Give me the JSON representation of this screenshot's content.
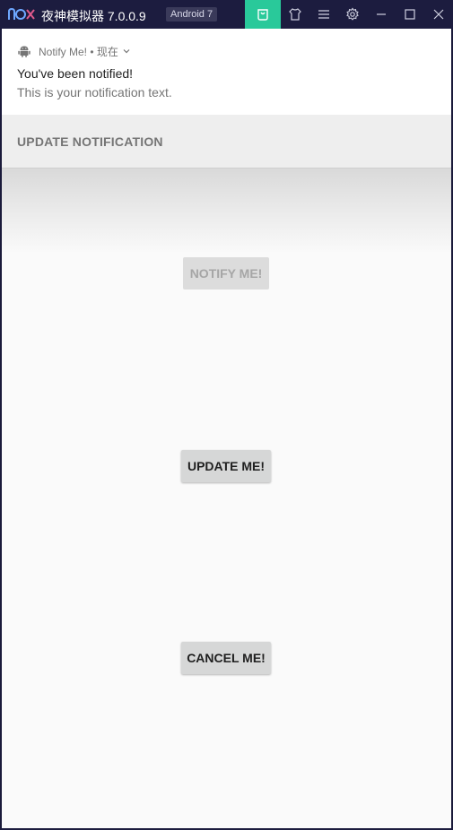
{
  "emulator": {
    "logo_text": "nox",
    "title": "夜神模拟器 7.0.0.9",
    "android_badge": "Android 7",
    "controls": [
      "store-icon",
      "shirt-icon",
      "menu-icon",
      "gear-icon",
      "minimize-icon",
      "maximize-icon",
      "close-icon"
    ],
    "accent": "#29c99a"
  },
  "notification": {
    "app_icon": "android-icon",
    "app_name": "Notify Me! • 现在",
    "title": "You've been notified!",
    "text": "This is your notification text.",
    "action_label": "UPDATE NOTIFICATION"
  },
  "app": {
    "notify_label": "NOTIFY ME!",
    "update_label": "UPDATE ME!",
    "cancel_label": "CANCEL ME!"
  }
}
